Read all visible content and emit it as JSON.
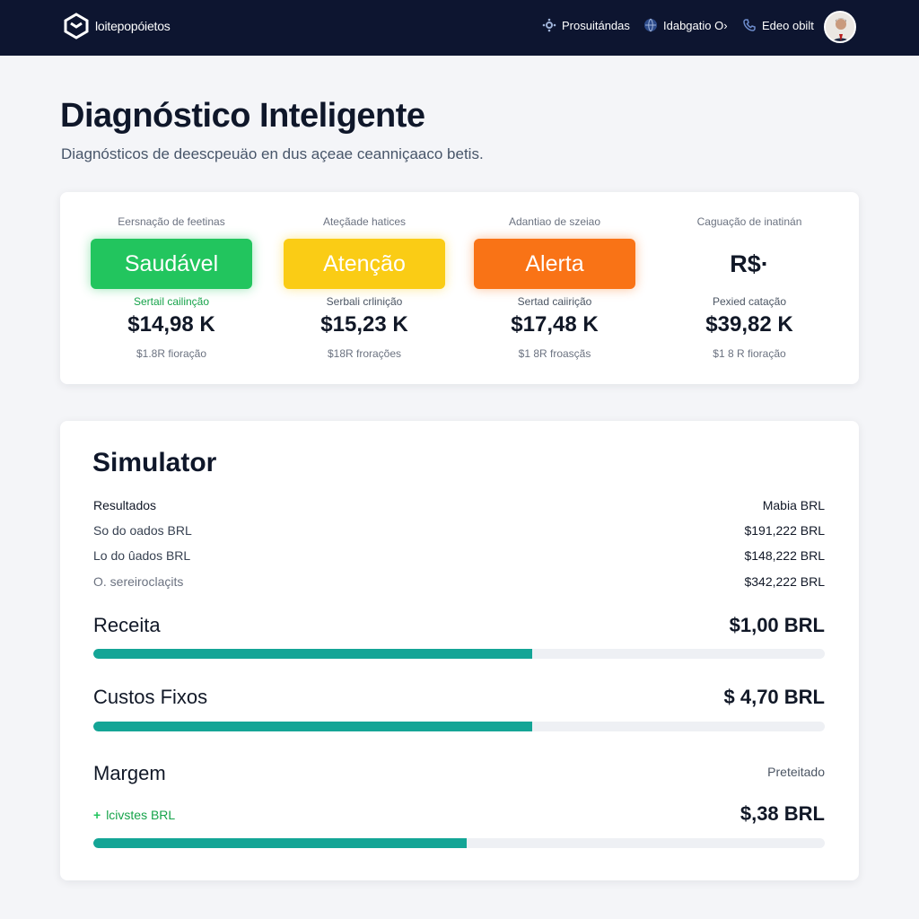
{
  "header": {
    "brand": "loitepopóietos",
    "nav": [
      {
        "label": "Prosuitándas",
        "icon": "settings-icon"
      },
      {
        "label": "Idabgatio O›",
        "icon": "globe-icon"
      },
      {
        "label": "Edeo obilt",
        "icon": "phone-icon"
      }
    ],
    "avatar_icon": "user-avatar"
  },
  "page": {
    "title": "Diagnóstico Inteligente",
    "subtitle": "Diagnósticos de deescpeuäo en dus açeae ceanniçaaco betis."
  },
  "status": [
    {
      "caption": "Eersnação de feetinas",
      "badge": "Saudável",
      "color": "#22c55e",
      "sub": "Sertail cailinção",
      "value": "$14,98 K",
      "note": "$1.8R fioração"
    },
    {
      "caption": "Ateçãade hatices",
      "badge": "Atenção",
      "color": "#facc15",
      "sub": "Serbali crlinição",
      "value": "$15,23 K",
      "note": "$18R frorações"
    },
    {
      "caption": "Adantiao de szeiao",
      "badge": "Alerta",
      "color": "#f97316",
      "sub": "Sertad caiirição",
      "value": "$17,48 K",
      "note": "$1 8R froasçãs"
    },
    {
      "caption": "Caguação de inatinán",
      "badge": "R$·",
      "color": "",
      "sub": "Pexied catação",
      "value": "$39,82 K",
      "note": "$1 8 R fioração"
    }
  ],
  "simulator": {
    "title": "Simulator",
    "header_left": "Resultados",
    "header_right": "Mabia BRL",
    "rows": [
      {
        "label": "So do oados BRL",
        "value": "$191,222 BRL"
      },
      {
        "label": "Lo do ûados BRL",
        "value": "$148,222 BRL"
      },
      {
        "label": "O. sereiroclaçits",
        "value": "$342,222 BRL"
      }
    ],
    "receita": {
      "label": "Receita",
      "value": "$1,00 BRL",
      "progress": 0.6
    },
    "custos": {
      "label": "Custos Fixos",
      "value": "$ 4,70 BRL",
      "progress": 0.6
    },
    "margem": {
      "label": "Margem",
      "right_caption": "Preteitado",
      "sub_label": "lcivstes BRL",
      "value": "$,38 BRL",
      "progress": 0.51
    }
  }
}
